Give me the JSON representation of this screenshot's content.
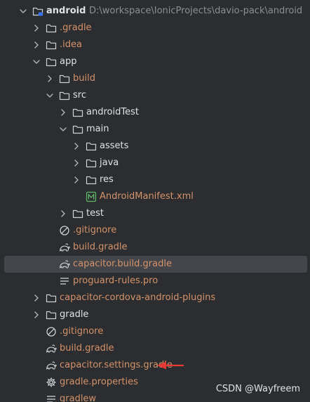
{
  "colors": {
    "default": "#dfe1e5",
    "excluded": "#d4936a",
    "modified": "#d4936a",
    "muted": "#8c8f94",
    "arrow": "#e53935"
  },
  "tree": [
    {
      "label": "android",
      "bold": true,
      "path": "D:\\workspace\\IonicProjects\\davio-pack\\android",
      "depth": 0,
      "expand": "open",
      "icon": "module-folder-icon",
      "color": "default"
    },
    {
      "label": ".gradle",
      "depth": 1,
      "expand": "closed",
      "icon": "folder-icon",
      "color": "excluded"
    },
    {
      "label": ".idea",
      "depth": 1,
      "expand": "closed",
      "icon": "folder-icon",
      "color": "excluded"
    },
    {
      "label": "app",
      "depth": 1,
      "expand": "open",
      "icon": "folder-icon",
      "color": "default"
    },
    {
      "label": "build",
      "depth": 2,
      "expand": "closed",
      "icon": "folder-icon",
      "color": "excluded"
    },
    {
      "label": "src",
      "depth": 2,
      "expand": "open",
      "icon": "folder-icon",
      "color": "default"
    },
    {
      "label": "androidTest",
      "depth": 3,
      "expand": "closed",
      "icon": "folder-icon",
      "color": "default"
    },
    {
      "label": "main",
      "depth": 3,
      "expand": "open",
      "icon": "folder-icon",
      "color": "default"
    },
    {
      "label": "assets",
      "depth": 4,
      "expand": "closed",
      "icon": "folder-icon",
      "color": "default"
    },
    {
      "label": "java",
      "depth": 4,
      "expand": "closed",
      "icon": "folder-icon",
      "color": "default"
    },
    {
      "label": "res",
      "depth": 4,
      "expand": "closed",
      "icon": "folder-icon",
      "color": "default"
    },
    {
      "label": "AndroidManifest.xml",
      "depth": 4,
      "expand": "none",
      "icon": "manifest-icon",
      "color": "modified"
    },
    {
      "label": "test",
      "depth": 3,
      "expand": "closed",
      "icon": "folder-icon",
      "color": "default"
    },
    {
      "label": ".gitignore",
      "depth": 2,
      "expand": "none",
      "icon": "gitignore-icon",
      "color": "modified"
    },
    {
      "label": "build.gradle",
      "depth": 2,
      "expand": "none",
      "icon": "gradle-icon",
      "color": "modified"
    },
    {
      "label": "capacitor.build.gradle",
      "depth": 2,
      "expand": "none",
      "icon": "gradle-icon",
      "color": "modified",
      "selected": true
    },
    {
      "label": "proguard-rules.pro",
      "depth": 2,
      "expand": "none",
      "icon": "text-file-icon",
      "color": "modified"
    },
    {
      "label": "capacitor-cordova-android-plugins",
      "depth": 1,
      "expand": "closed",
      "icon": "folder-icon",
      "color": "modified"
    },
    {
      "label": "gradle",
      "depth": 1,
      "expand": "closed",
      "icon": "folder-icon",
      "color": "default"
    },
    {
      "label": ".gitignore",
      "depth": 1,
      "expand": "none",
      "icon": "gitignore-icon",
      "color": "modified"
    },
    {
      "label": "build.gradle",
      "depth": 1,
      "expand": "none",
      "icon": "gradle-icon",
      "color": "modified"
    },
    {
      "label": "capacitor.settings.gradle",
      "depth": 1,
      "expand": "none",
      "icon": "gradle-icon",
      "color": "modified",
      "annotated": true
    },
    {
      "label": "gradle.properties",
      "depth": 1,
      "expand": "none",
      "icon": "settings-gear-icon",
      "color": "modified"
    },
    {
      "label": "gradlew",
      "depth": 1,
      "expand": "none",
      "icon": "text-file-icon",
      "color": "modified"
    }
  ],
  "watermark": "CSDN @Wayfreem"
}
